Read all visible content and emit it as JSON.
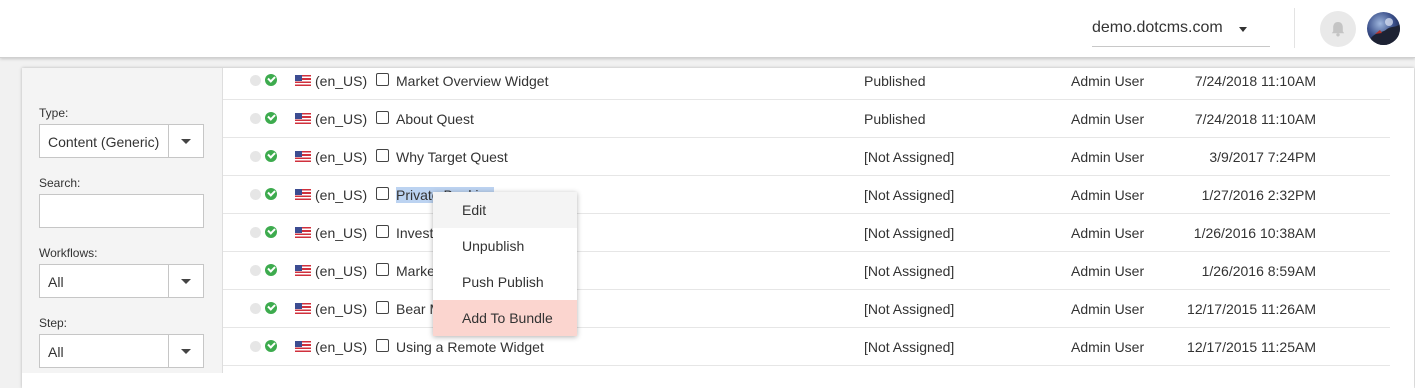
{
  "header": {
    "site": "demo.dotcms.com",
    "icons": {
      "caret": "chevron-down-icon",
      "notifications": "bell-icon",
      "avatar": "user-avatar"
    }
  },
  "filters": {
    "type_label": "Type:",
    "type_value": "Content (Generic)",
    "search_label": "Search:",
    "search_value": "",
    "workflows_label": "Workflows:",
    "workflows_value": "All",
    "step_label": "Step:",
    "step_value": "All"
  },
  "rows": [
    {
      "lang": "(en_US)",
      "title": "Market Overview Widget",
      "status": "Published",
      "user": "Admin User",
      "date": "7/24/2018 11:10AM"
    },
    {
      "lang": "(en_US)",
      "title": "About Quest",
      "status": "Published",
      "user": "Admin User",
      "date": "7/24/2018 11:10AM"
    },
    {
      "lang": "(en_US)",
      "title": "Why Target Quest",
      "status": "[Not Assigned]",
      "user": "Admin User",
      "date": "3/9/2017 7:24PM"
    },
    {
      "lang": "(en_US)",
      "title": "Private Banking",
      "status": "[Not Assigned]",
      "user": "Admin User",
      "date": "1/27/2016 2:32PM"
    },
    {
      "lang": "(en_US)",
      "title": "Investment Services",
      "status": "[Not Assigned]",
      "user": "Admin User",
      "date": "1/26/2016 10:38AM"
    },
    {
      "lang": "(en_US)",
      "title": "Market Overview",
      "status": "[Not Assigned]",
      "user": "Admin User",
      "date": "1/26/2016 8:59AM"
    },
    {
      "lang": "(en_US)",
      "title": "Bear Market Fundamentals",
      "status": "[Not Assigned]",
      "user": "Admin User",
      "date": "12/17/2015 11:26AM"
    },
    {
      "lang": "(en_US)",
      "title": "Using a Remote Widget",
      "status": "[Not Assigned]",
      "user": "Admin User",
      "date": "12/17/2015 11:25AM"
    }
  ],
  "context_menu": {
    "items": [
      "Edit",
      "Unpublish",
      "Push Publish",
      "Add To Bundle"
    ]
  },
  "colors": {
    "published_check": "#3dab4e",
    "menu_highlight": "#fbd5cf",
    "text_selection": "#bcd3f1"
  }
}
